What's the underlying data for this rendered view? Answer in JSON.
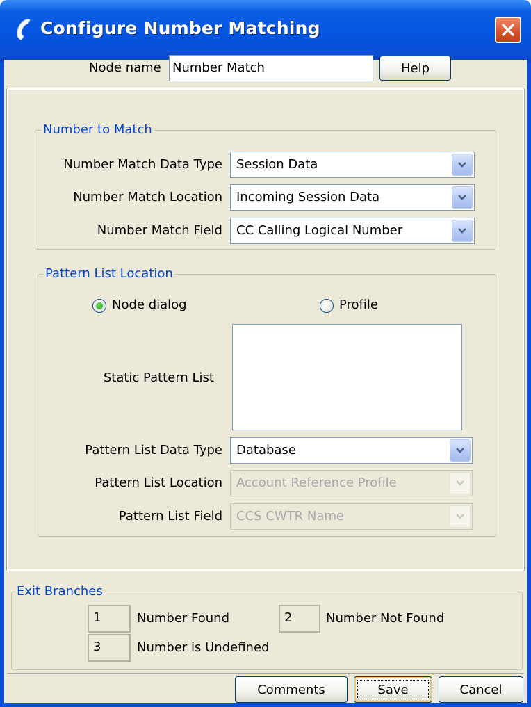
{
  "window": {
    "title": "Configure Number Matching",
    "icon": "phone-handset-icon",
    "colors": {
      "titlebar": "#0554e0",
      "window_bg": "#ece9d8",
      "legend": "#0046d5",
      "close": "#d8502a"
    }
  },
  "header": {
    "node_name_label": "Node name",
    "node_name_value": "Number Match",
    "help_label": "Help"
  },
  "number_to_match": {
    "legend": "Number to Match",
    "data_type_label": "Number Match Data Type",
    "data_type_value": "Session Data",
    "location_label": "Number Match Location",
    "location_value": "Incoming Session Data",
    "field_label": "Number Match Field",
    "field_value": "CC Calling Logical Number"
  },
  "pattern_list": {
    "legend": "Pattern List Location",
    "radio_node_dialog": "Node dialog",
    "radio_profile": "Profile",
    "selected_radio": "Node dialog",
    "static_list_label": "Static Pattern List",
    "data_type_label": "Pattern List Data Type",
    "data_type_value": "Database",
    "location_label": "Pattern List Location",
    "location_value": "Account Reference Profile",
    "field_label": "Pattern List Field",
    "field_value": "CCS CWTR Name"
  },
  "exit_branches": {
    "legend": "Exit Branches",
    "items": [
      {
        "number": "1",
        "label": "Number Found"
      },
      {
        "number": "2",
        "label": "Number Not Found"
      },
      {
        "number": "3",
        "label": "Number is Undefined"
      }
    ]
  },
  "footer": {
    "comments_label": "Comments",
    "save_label": "Save",
    "cancel_label": "Cancel"
  }
}
